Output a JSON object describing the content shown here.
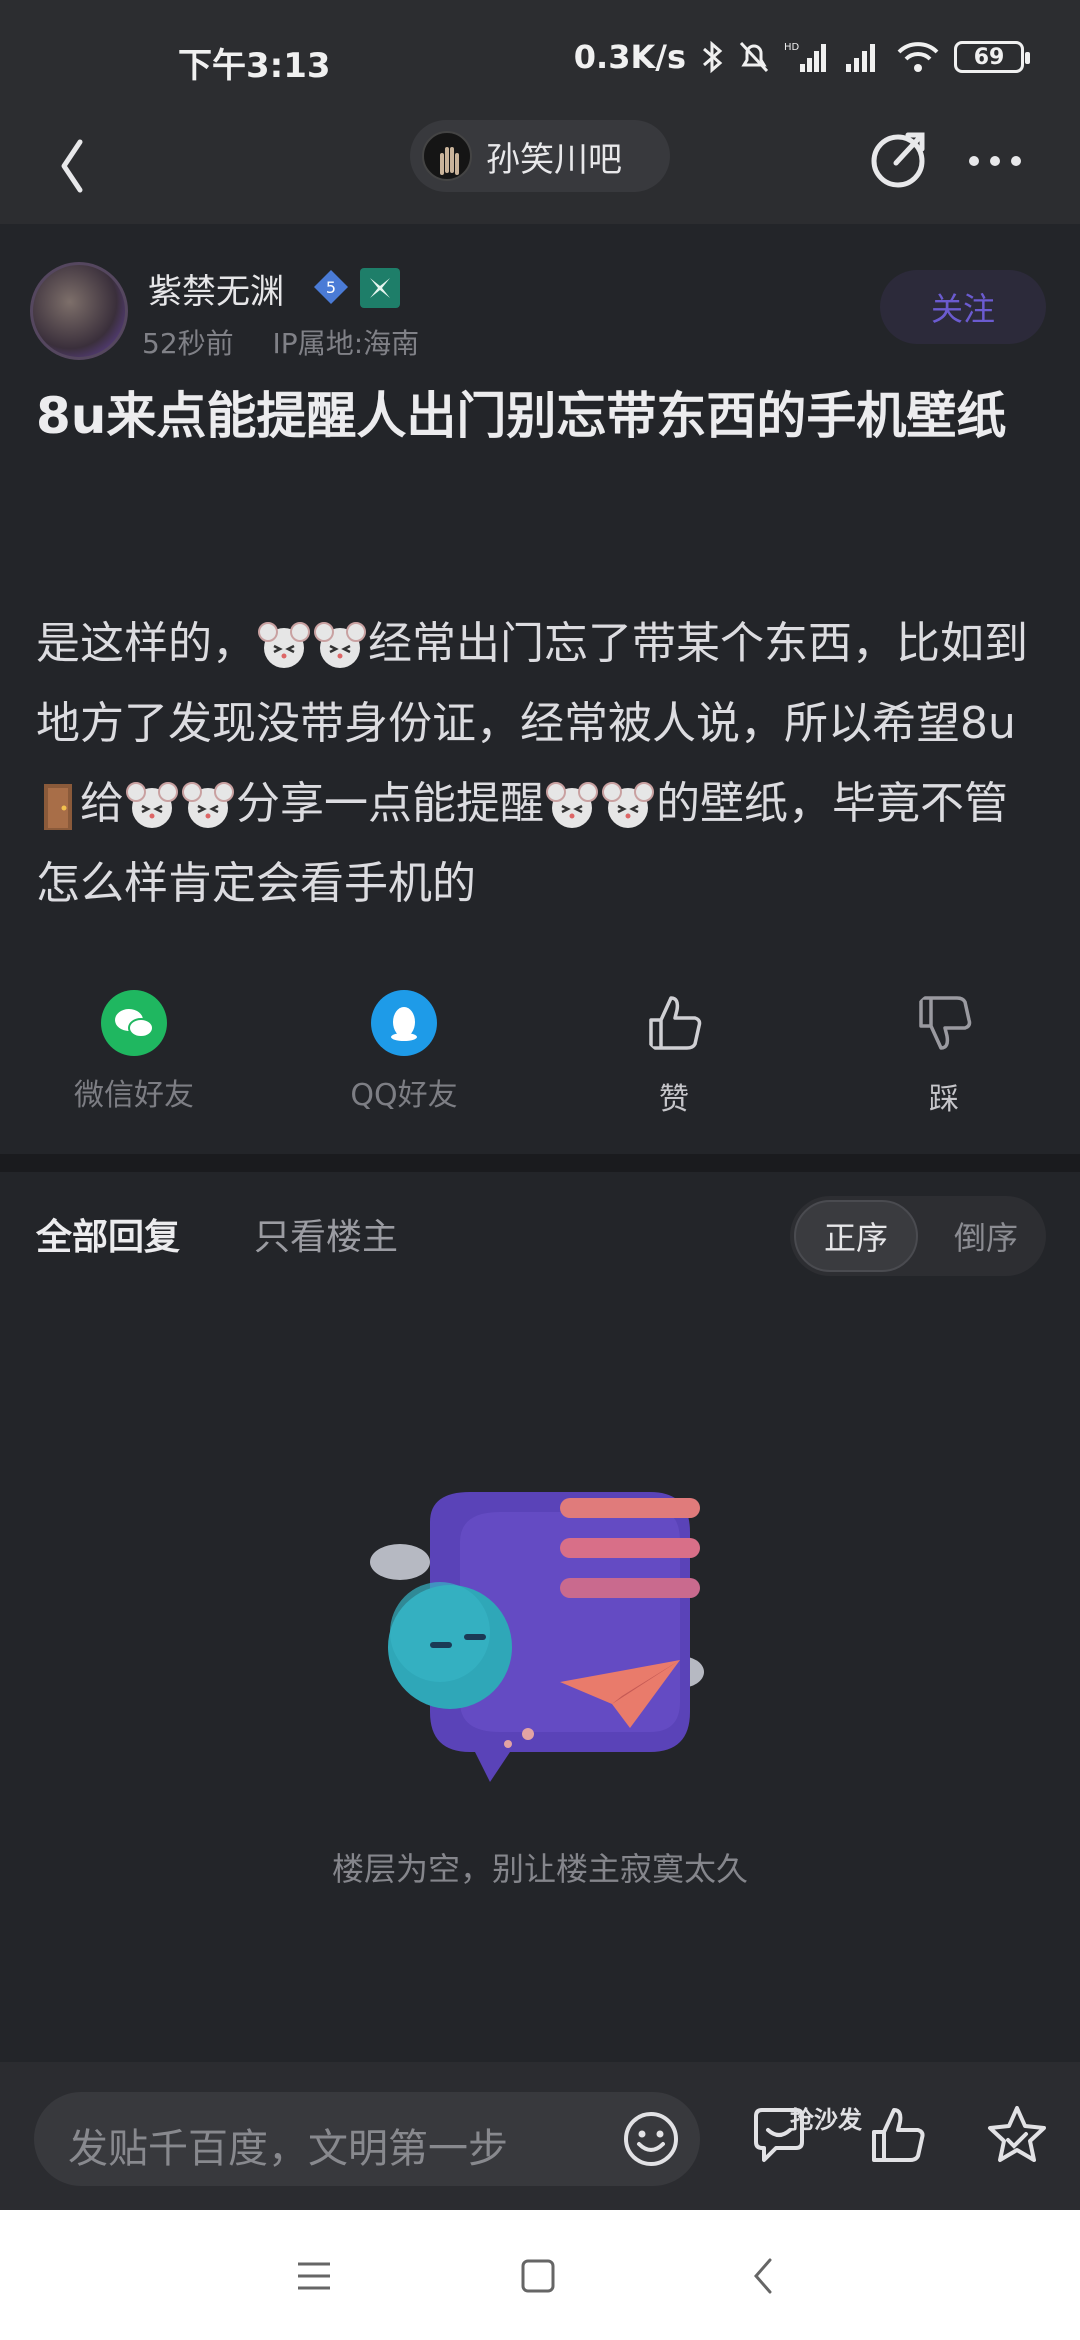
{
  "status_bar": {
    "time": "下午3:13",
    "net_speed": "0.3K/s",
    "battery": "69"
  },
  "nav": {
    "forum_name": "孙笑川吧"
  },
  "post": {
    "author": {
      "name": "紫禁无渊",
      "level": "5",
      "time_ago": "52秒前",
      "ip_location": "IP属地:海南"
    },
    "follow_label": "关注",
    "title": "8u来点能提醒人出门别忘带东西的手机壁纸",
    "body_parts": {
      "p1": "是这样的，",
      "p2": "经常出门忘了带某个东西，比如到地方了发现没带身份证，经常被人说，所以希望8u",
      "p3": "给",
      "p4": "分享一点能提醒",
      "p5": "的壁纸，毕竟不管怎么样肯定会看手机的"
    },
    "actions": {
      "wechat": "微信好友",
      "qq": "QQ好友",
      "like": "赞",
      "dislike": "踩"
    }
  },
  "replies": {
    "tab_all": "全部回复",
    "tab_op_only": "只看楼主",
    "order_asc": "正序",
    "order_desc": "倒序",
    "empty_text": "楼层为空，别让楼主寂寞太久"
  },
  "bottom_bar": {
    "input_placeholder": "发贴千百度，文明第一步",
    "sofa_label": "抢沙发"
  },
  "colors": {
    "background": "#232529",
    "accent_purple": "#6b5bd0",
    "wechat_green": "#1fb760",
    "qq_blue": "#1e9be8"
  }
}
